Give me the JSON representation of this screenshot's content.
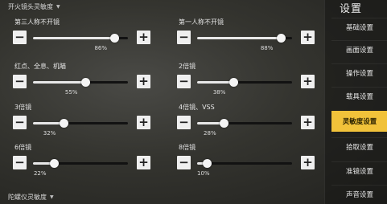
{
  "sections": {
    "scope_sensitivity": "开火镜头灵敏度",
    "gyro_sensitivity": "陀螺仪灵敏度"
  },
  "sliders": [
    {
      "label": "第三人称不开镜",
      "value": 86
    },
    {
      "label": "第一人称不开镜",
      "value": 88
    },
    {
      "label": "红点、全息、机瞄",
      "value": 55
    },
    {
      "label": "2倍镜",
      "value": 38
    },
    {
      "label": "3倍镜",
      "value": 32
    },
    {
      "label": "4倍镜、VSS",
      "value": 28
    },
    {
      "label": "6倍镜",
      "value": 22
    },
    {
      "label": "8倍镜",
      "value": 10
    }
  ],
  "slider_text": [
    {
      "pct": "86%",
      "minus": "−",
      "plus": "+"
    },
    {
      "pct": "88%",
      "minus": "−",
      "plus": "+"
    },
    {
      "pct": "55%",
      "minus": "−",
      "plus": "+"
    },
    {
      "pct": "38%",
      "minus": "−",
      "plus": "+"
    },
    {
      "pct": "32%",
      "minus": "−",
      "plus": "+"
    },
    {
      "pct": "28%",
      "minus": "−",
      "plus": "+"
    },
    {
      "pct": "22%",
      "minus": "−",
      "plus": "+"
    },
    {
      "pct": "10%",
      "minus": "−",
      "plus": "+"
    }
  ],
  "sidebar": {
    "title": "设置",
    "items": [
      {
        "label": "基础设置"
      },
      {
        "label": "画面设置"
      },
      {
        "label": "操作设置"
      },
      {
        "label": "载具设置"
      },
      {
        "label": "灵敏度设置",
        "active": true
      },
      {
        "label": "拾取设置"
      },
      {
        "label": "准镜设置"
      },
      {
        "label": "声音设置"
      }
    ]
  },
  "colors": {
    "accent": "#f1c23a",
    "button": "#efefef",
    "track": "#121212",
    "fill": "#e8e8e8"
  }
}
